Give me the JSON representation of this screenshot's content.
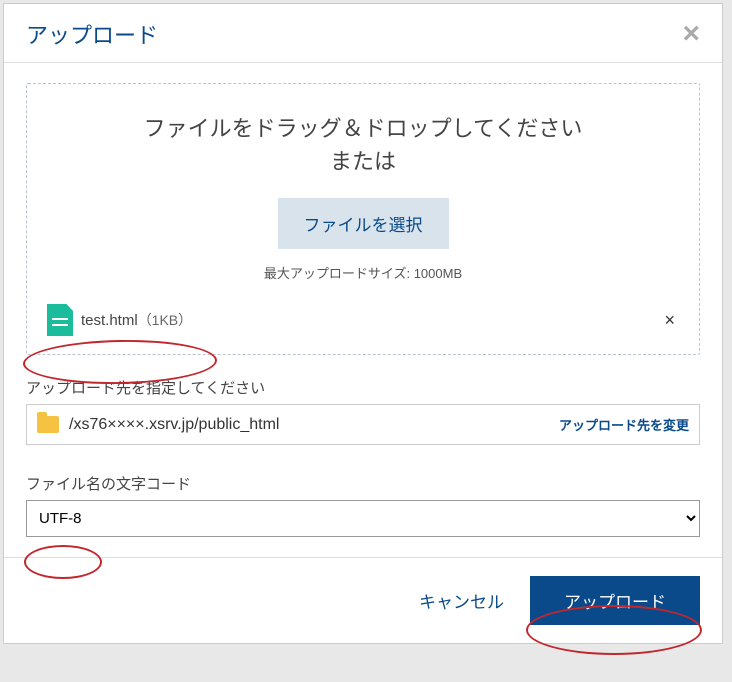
{
  "modal": {
    "title": "アップロード"
  },
  "dropzone": {
    "line1": "ファイルをドラッグ＆ドロップしてください",
    "line2": "または",
    "choose_button": "ファイルを選択",
    "max_size": "最大アップロードサイズ: 1000MB"
  },
  "file": {
    "name": "test.html",
    "size": "（1KB）"
  },
  "destination": {
    "label": "アップロード先を指定してください",
    "path": "/xs76××××.xsrv.jp/public_html",
    "change_link": "アップロード先を変更"
  },
  "encoding": {
    "label": "ファイル名の文字コード",
    "selected": "UTF-8"
  },
  "footer": {
    "cancel": "キャンセル",
    "upload": "アップロード"
  }
}
